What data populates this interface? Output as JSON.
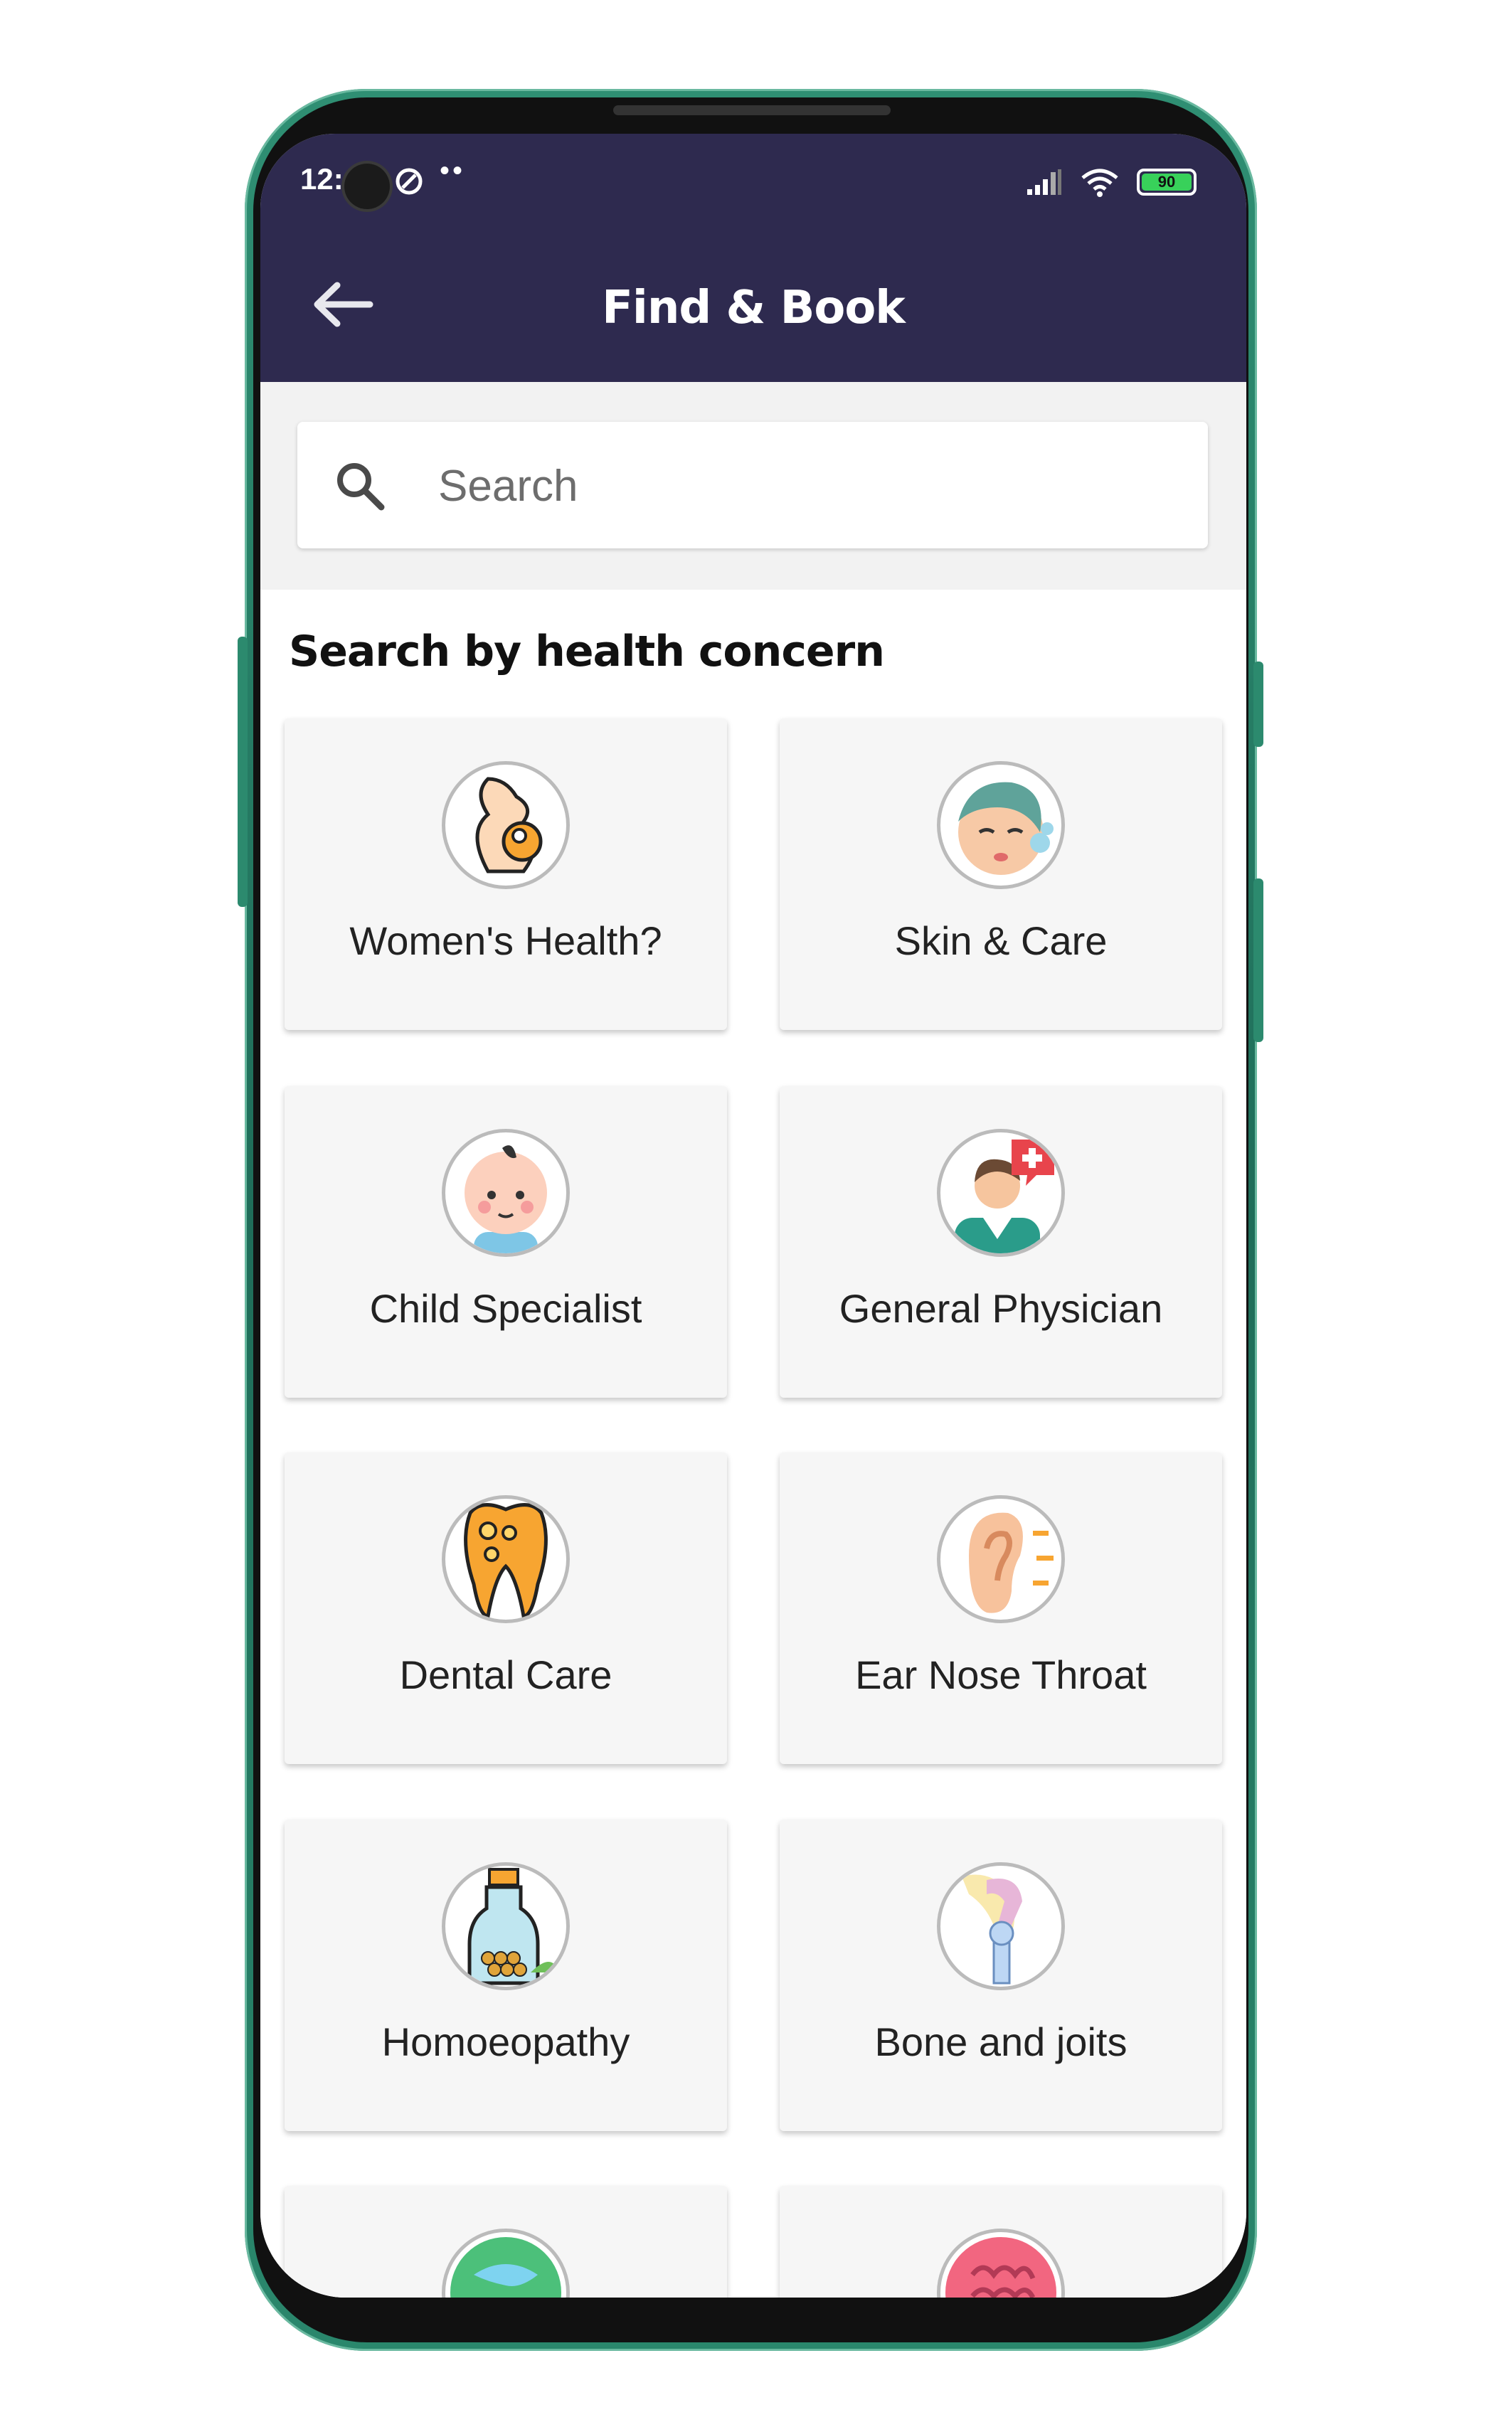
{
  "status_bar": {
    "time": "12:",
    "dots": "••",
    "battery": "90"
  },
  "app_bar": {
    "title": "Find & Book"
  },
  "search": {
    "placeholder": "Search"
  },
  "section": {
    "title": "Search by health concern"
  },
  "concerns": [
    {
      "label": "Women's Health?",
      "icon": "pregnancy-icon"
    },
    {
      "label": "Skin & Care",
      "icon": "skin-care-icon"
    },
    {
      "label": "Child Specialist",
      "icon": "baby-icon"
    },
    {
      "label": "General Physician",
      "icon": "doctor-icon"
    },
    {
      "label": "Dental Care",
      "icon": "tooth-icon"
    },
    {
      "label": "Ear Nose Throat",
      "icon": "ear-icon"
    },
    {
      "label": "Homoeopathy",
      "icon": "medicine-bottle-icon"
    },
    {
      "label": "Bone and joits",
      "icon": "bone-joint-icon"
    },
    {
      "label": "",
      "icon": "globe-icon"
    },
    {
      "label": "",
      "icon": "brain-icon"
    }
  ],
  "colors": {
    "appbar": "#2e2a4f",
    "frame": "#1f6d59",
    "card": "#f6f6f6"
  }
}
